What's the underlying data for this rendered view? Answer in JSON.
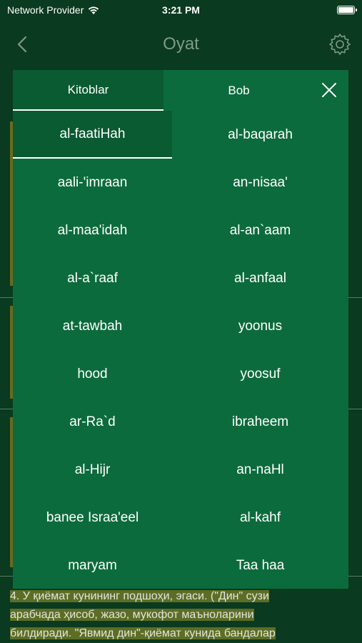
{
  "status": {
    "carrier": "Network Provider",
    "time": "3:21 PM"
  },
  "nav": {
    "title": "Oyat"
  },
  "background": {
    "verse_lines": [
      "4. У қиёмат кунининг подшоҳи, эгаси. (\"Дин\" сузи",
      "арабчада ҳисоб, жазо, мукофот маъноларини",
      "билдиради. \"Явмид дин\"-қиёмат кунида бандалар"
    ]
  },
  "modal": {
    "tabs": [
      {
        "label": "Kitoblar",
        "active": true
      },
      {
        "label": "Bob",
        "active": false
      }
    ],
    "books": [
      "al-faatiHah",
      "al-baqarah",
      "aali-'imraan",
      "an-nisaa'",
      "al-maa'idah",
      "al-an`aam",
      "al-a`raaf",
      "al-anfaal",
      "at-tawbah",
      "yoonus",
      "hood",
      "yoosuf",
      "ar-Ra`d",
      "ibraheem",
      "al-Hijr",
      "an-naHl",
      "banee Israa'eel",
      "al-kahf",
      "maryam",
      "Taa haa"
    ],
    "selected_index": 0
  },
  "colors": {
    "background": "#0a3a1f",
    "modal": "#0c6b3c",
    "active_tab": "#0a5a32",
    "highlight": "#5e6d25"
  }
}
